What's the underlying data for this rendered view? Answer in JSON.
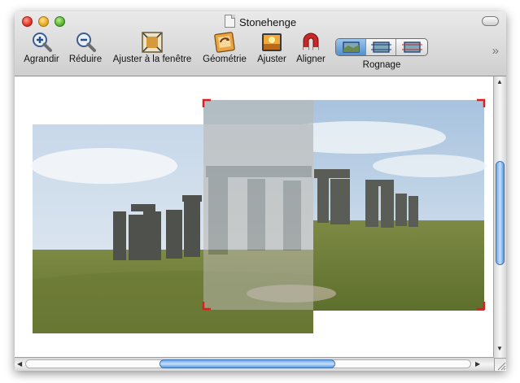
{
  "window": {
    "title": "Stonehenge"
  },
  "toolbar": {
    "zoom_in": "Agrandir",
    "zoom_out": "Réduire",
    "fit_window": "Ajuster à la fenêtre",
    "geometry": "Géométrie",
    "adjust": "Ajuster",
    "align": "Aligner",
    "crop": "Rognage"
  },
  "icons": {
    "zoom_in": "magnifier-plus-icon",
    "zoom_out": "magnifier-minus-icon",
    "fit_window": "fit-to-window-icon",
    "geometry": "geometry-icon",
    "adjust": "adjust-icon",
    "align": "magnet-icon",
    "crop_modes": [
      "crop-mode-1-icon",
      "crop-mode-2-icon",
      "crop-mode-3-icon"
    ],
    "overflow": "toolbar-overflow-icon"
  },
  "crop": {
    "selected_mode": 1
  },
  "colors": {
    "crop_marks": "#e01c1c",
    "selection": "#5c98d8"
  }
}
